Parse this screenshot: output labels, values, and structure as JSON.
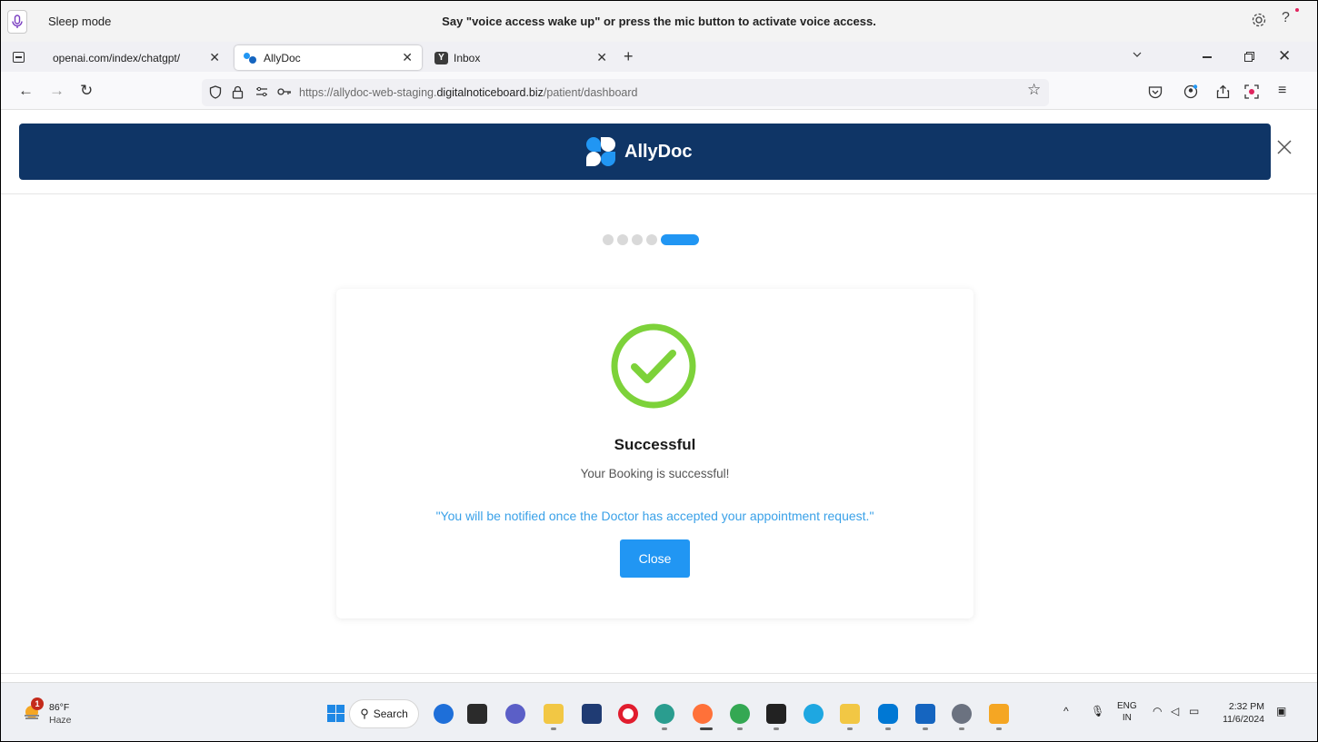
{
  "voice_access": {
    "status": "Sleep mode",
    "message": "Say \"voice access wake up\" or press the mic button to activate voice access."
  },
  "tabs": [
    {
      "label": "openai.com/index/chatgpt/",
      "active": false
    },
    {
      "label": "AllyDoc",
      "active": true
    },
    {
      "label": "Inbox",
      "active": false
    }
  ],
  "address": {
    "url_prefix": "https://allydoc-web-staging.",
    "url_domain": "digitalnoticeboard.biz",
    "url_path": "/patient/dashboard"
  },
  "app": {
    "brand": "AllyDoc",
    "brand_color": "#0f3566",
    "accent_color": "#2196f3"
  },
  "stepper": {
    "total_steps": 5,
    "current_step": 5
  },
  "dialog": {
    "title": "Successful",
    "subtitle": "Your Booking is successful!",
    "note": "\"You will be notified once the Doctor has accepted your appointment request.\"",
    "close_label": "Close"
  },
  "taskbar": {
    "weather_temp": "86°F",
    "weather_desc": "Haze",
    "weather_badge": "1",
    "search_label": "Search",
    "lang_line1": "ENG",
    "lang_line2": "IN",
    "time": "2:32 PM",
    "date": "11/6/2024"
  }
}
